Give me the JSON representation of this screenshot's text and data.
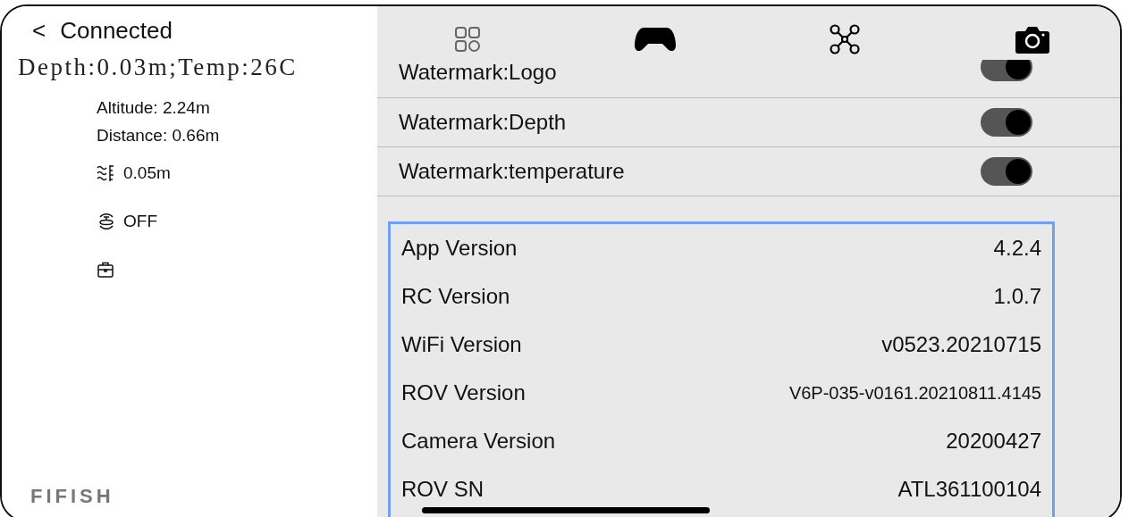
{
  "header": {
    "back": "<",
    "title": "Connected"
  },
  "telemetry": "Depth:0.03m;Temp:26C",
  "stats": [
    "Altitude: 2.24m",
    "Distance: 0.66m"
  ],
  "indicators": [
    {
      "kind": "water",
      "text": "0.05m"
    },
    {
      "kind": "stabilize",
      "text": "OFF"
    },
    {
      "kind": "toolbox"
    }
  ],
  "brand": "FIFISH",
  "settings": [
    {
      "label": "Watermark:Logo",
      "on": true
    },
    {
      "label": "Watermark:Depth",
      "on": true
    },
    {
      "label": "Watermark:temperature",
      "on": true
    }
  ],
  "versions": [
    {
      "label": "App Version",
      "value": "4.2.4"
    },
    {
      "label": "RC Version",
      "value": "1.0.7"
    },
    {
      "label": "WiFi Version",
      "value": "v0523.20210715"
    },
    {
      "label": "ROV Version",
      "value": "V6P-035-v0161.20210811.4145"
    },
    {
      "label": "Camera Version",
      "value": "20200427"
    },
    {
      "label": "ROV SN",
      "value": "ATL361100104"
    }
  ]
}
